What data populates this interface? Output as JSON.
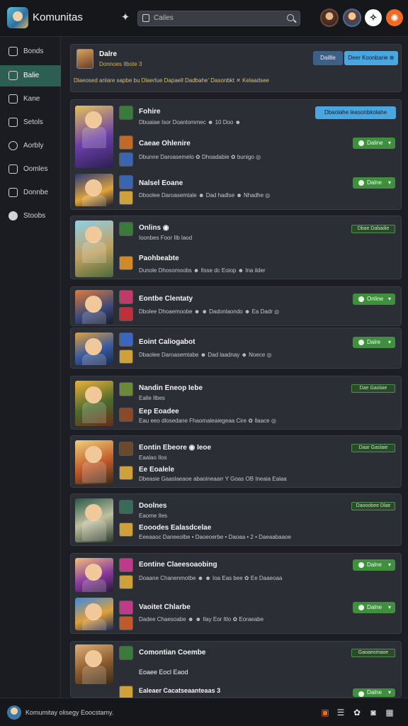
{
  "app": {
    "title": "Komunitas"
  },
  "search": {
    "value": "Cailes"
  },
  "sidebar": {
    "items": [
      {
        "label": "Bonds",
        "icon": "grid-icon"
      },
      {
        "label": "Balie",
        "icon": "chart-icon",
        "active": true
      },
      {
        "label": "Kane",
        "icon": "square-icon"
      },
      {
        "label": "Setols",
        "icon": "document-icon"
      },
      {
        "label": "Aorbly",
        "icon": "clock-icon"
      },
      {
        "label": "Oomles",
        "icon": "image-icon"
      },
      {
        "label": "Donnbe",
        "icon": "stack-icon"
      },
      {
        "label": "Stoobs",
        "icon": "circle-icon"
      }
    ]
  },
  "header": {
    "title": "Dalre",
    "subtitle": "Donnoes Ilbote 3",
    "button1": "Daillle",
    "button2": "Deer Koonbarie ⊕",
    "line": "Dlaeosed anlare sapbe bu Dlaerlue Dapaell Dadbahe' Dasonbkt ✕ Kelaadsee"
  },
  "colors": {
    "accent_green": "#3f8f3f",
    "accent_blue": "#4aa6e0",
    "sidebar_active": "#2c5e52",
    "background": "#1c1e23"
  },
  "cards": [
    {
      "rows": [
        {
          "title": "Fohire",
          "meta": "Dbuaiae Isor Doanlommec ☻ 10 Doo ☻",
          "action": "Dbaolahe leasonbkolahe",
          "action_type": "blue"
        },
        {
          "title": "Caeae Ohlenire",
          "meta": "Dbunne Daroasemelo ✿ Dhoadabie ✿ bunigo ◎",
          "action": "Daline",
          "action_type": "button"
        },
        {
          "title": "Nalsel Eoane",
          "meta": "Dboolee Daroasemtale ☻ Dad hadlse ☻ Nhadhe ◎",
          "action": "Dalne",
          "action_type": "button"
        }
      ]
    },
    {
      "rows": [
        {
          "title": "Onlins ◉",
          "meta": "Ioonbes Foor Ilb laod",
          "action": "Dbae Dabadie",
          "action_type": "tag"
        },
        {
          "title": "Paohbeabte",
          "meta": "Dunole Dhosomoobs ☻ Ilsse dc Eoiop ☻ Ina ilder",
          "action": "",
          "action_type": "none"
        }
      ]
    },
    {
      "rows": [
        {
          "title": "Eontbe Clentaty",
          "meta": "Dbolee Dhoaemoobe ☻ ☻ Dadonlaondo ☻ Ea Dadr ◎",
          "action": "Online",
          "action_type": "button"
        }
      ]
    },
    {
      "rows": [
        {
          "title": "Eoint Caliogabot",
          "meta": "Dbaolee Daroasemtabe ☻ Dad laadnay ☻ Noece ◎",
          "action": "Dalre",
          "action_type": "button"
        }
      ]
    },
    {
      "rows": [
        {
          "title": "Nandin Eneop Iebe",
          "meta": "Ealle Ilbes",
          "action": "Dae Gaolaie",
          "action_type": "tag"
        },
        {
          "title": "Eep Eoadee",
          "meta": "Eau eeo dlosedane Fhaomaleaiegeaa Cire ✿ Ilaace ◎",
          "action": "",
          "action_type": "none"
        }
      ]
    },
    {
      "rows": [
        {
          "title": "Eontin Ebeore ◉ Ieoe",
          "meta": "Eaalao Ilos",
          "action": "Daar Gaslaie",
          "action_type": "tag"
        },
        {
          "title": "Ee Eoalele",
          "meta": "Dbeasie Gaaslaeaoe abaoineaarr Y Goas OB Ineaia Ealaa",
          "action": "",
          "action_type": "none"
        }
      ]
    },
    {
      "rows": [
        {
          "title": "Doolnes",
          "meta": "Eaome Iles",
          "action": "Daooobee Dlae",
          "action_type": "tag"
        },
        {
          "title": "Eooodes Ealasdcelae",
          "meta": "Eeeaaoc Daneeolbe • Daoeoerbe • Daoaa • 2 • Daeaabaaoe",
          "action": "",
          "action_type": "none"
        }
      ]
    },
    {
      "rows": [
        {
          "title": "Eontine Claeesoaobing",
          "meta": "Doaane Chanenmotbe ☻ ☻ Ioa Eas bee ✿ Ee Daaeoaa",
          "action": "Dalne",
          "action_type": "button"
        },
        {
          "title": "Vaoitet Chlarbe",
          "meta": "Dadee Chaesoabe ☻ ☻ Ilay Eor Itlo ✿ Eoraeabe",
          "action": "Dalne",
          "action_type": "button"
        }
      ]
    },
    {
      "rows": [
        {
          "title": "Comontian Coembe",
          "meta": "",
          "action": "Gaoaeomaoe",
          "action_type": "tag"
        },
        {
          "title": "Eoaee Eocl Eaod",
          "meta": "",
          "action": "",
          "action_type": "none"
        },
        {
          "title": "Ealeaer Cacatseaanteaas 3",
          "meta": "",
          "action": "Dalne",
          "action_type": "button"
        }
      ]
    }
  ],
  "bottom": {
    "text": "Komumitay olisegy Eoocstamy."
  }
}
